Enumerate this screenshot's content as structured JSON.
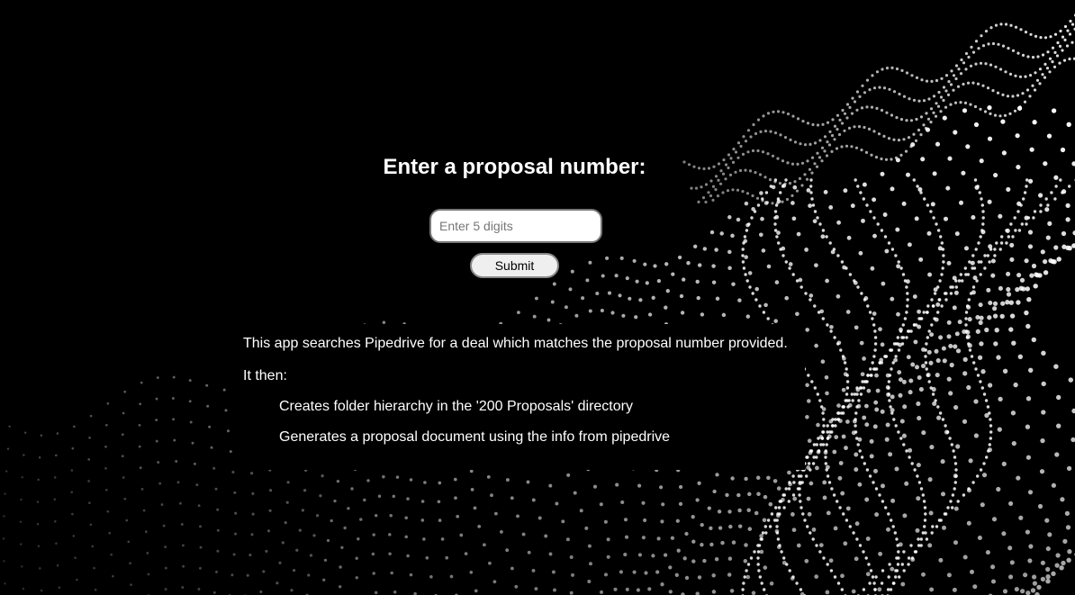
{
  "form": {
    "heading": "Enter a proposal number:",
    "input_placeholder": "Enter 5 digits",
    "input_value": "",
    "submit_label": "Submit"
  },
  "info": {
    "description": "This app searches Pipedrive for a deal which matches the proposal number provided.",
    "then_label": "It then:",
    "steps": [
      "Creates folder hierarchy in the '200 Proposals' directory",
      "Generates a proposal document using the info from pipedrive"
    ]
  },
  "colors": {
    "background": "#000000",
    "dots": "#ffffff",
    "text": "#ffffff"
  }
}
